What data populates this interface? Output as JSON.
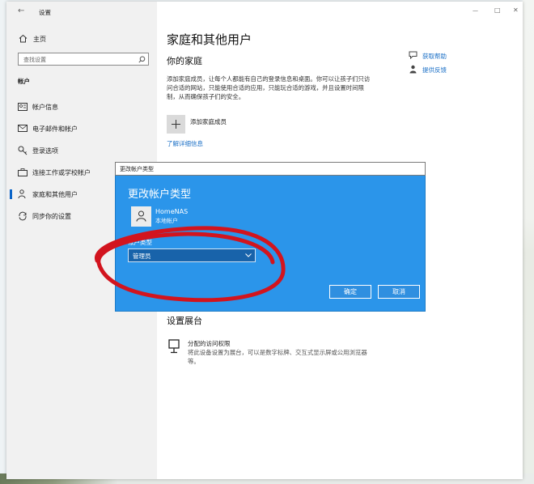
{
  "window": {
    "title": "设置",
    "back_glyph": "←",
    "minimize_glyph": "—",
    "maximize_glyph": "□",
    "close_glyph": "✕"
  },
  "sidebar": {
    "home_label": "主页",
    "search_placeholder": "查找设置",
    "section_title": "帐户",
    "items": [
      {
        "label": "帐户信息",
        "icon": "person-card-icon"
      },
      {
        "label": "电子邮件和帐户",
        "icon": "mail-icon"
      },
      {
        "label": "登录选项",
        "icon": "key-icon"
      },
      {
        "label": "连接工作或学校帐户",
        "icon": "briefcase-icon"
      },
      {
        "label": "家庭和其他用户",
        "icon": "people-icon"
      },
      {
        "label": "同步你的设置",
        "icon": "sync-icon"
      }
    ]
  },
  "main": {
    "page_title": "家庭和其他用户",
    "family_heading": "你的家庭",
    "family_description": "添加家庭成员，让每个人都能有自己的登录信息和桌面。你可以让孩子们只访问合适的网站，只能使用合适的应用，只能玩合适的游戏，并且设置时间限制，从而确保孩子们的安全。",
    "add_family_label": "添加家庭成员",
    "learn_more_link": "了解详细信息",
    "kiosk_heading": "设置展台",
    "assigned_access_title": "分配的访问权限",
    "assigned_access_desc": "将此设备设置为展台，可以是数字标牌、交互式显示屏或公用浏览器等。"
  },
  "help": {
    "get_help": "获取帮助",
    "feedback": "提供反馈"
  },
  "dialog": {
    "window_title": "更改帐户类型",
    "heading": "更改帐户类型",
    "user_name": "HomeNAS",
    "user_subtitle": "本地帐户",
    "type_label": "帐户类型",
    "selected_type": "管理员",
    "ok_label": "确定",
    "cancel_label": "取消"
  },
  "colors": {
    "dialog_bg": "#2b95ea",
    "select_bg": "#1863aa",
    "annotation": "#d2141e",
    "link": "#1a6fc6"
  }
}
